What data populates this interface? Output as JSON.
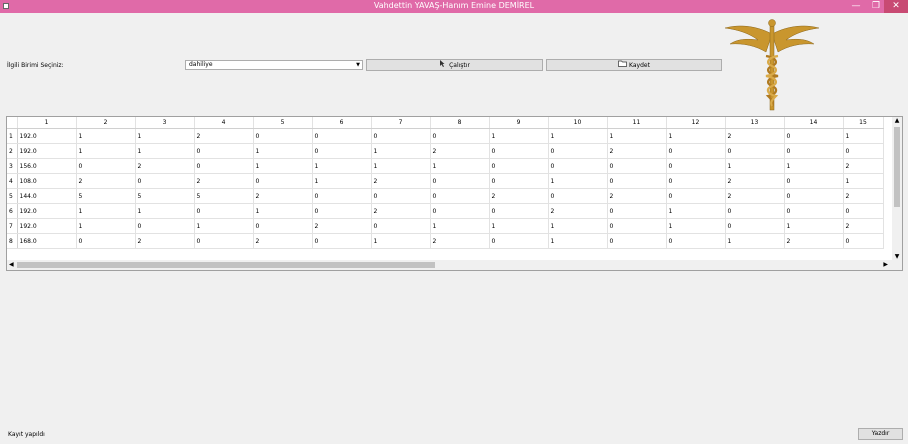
{
  "window": {
    "title": "Vahdettin YAVAŞ-Hanım Emine DEMİREL",
    "min": "—",
    "max": "❐",
    "close": "✕"
  },
  "form": {
    "label": "İlgili Birimi Seçiniz:",
    "selected_unit": "dahiliye",
    "run_label": "Çalıştır",
    "save_label": "Kaydet"
  },
  "table": {
    "columns": [
      "1",
      "2",
      "3",
      "4",
      "5",
      "6",
      "7",
      "8",
      "9",
      "10",
      "11",
      "12",
      "13",
      "14",
      "15"
    ],
    "rows": [
      {
        "n": "1",
        "cells": [
          "192.0",
          "1",
          "1",
          "2",
          "0",
          "0",
          "0",
          "0",
          "1",
          "1",
          "1",
          "1",
          "2",
          "0",
          "1"
        ]
      },
      {
        "n": "2",
        "cells": [
          "192.0",
          "1",
          "1",
          "0",
          "1",
          "0",
          "1",
          "2",
          "0",
          "0",
          "2",
          "0",
          "0",
          "0",
          "0"
        ]
      },
      {
        "n": "3",
        "cells": [
          "156.0",
          "0",
          "2",
          "0",
          "1",
          "1",
          "1",
          "1",
          "0",
          "0",
          "0",
          "0",
          "1",
          "1",
          "2"
        ]
      },
      {
        "n": "4",
        "cells": [
          "108.0",
          "2",
          "0",
          "2",
          "0",
          "1",
          "2",
          "0",
          "0",
          "1",
          "0",
          "0",
          "2",
          "0",
          "1"
        ]
      },
      {
        "n": "5",
        "cells": [
          "144.0",
          "5",
          "5",
          "5",
          "2",
          "0",
          "0",
          "0",
          "2",
          "0",
          "2",
          "0",
          "2",
          "0",
          "2"
        ]
      },
      {
        "n": "6",
        "cells": [
          "192.0",
          "1",
          "1",
          "0",
          "1",
          "0",
          "2",
          "0",
          "0",
          "2",
          "0",
          "1",
          "0",
          "0",
          "0"
        ]
      },
      {
        "n": "7",
        "cells": [
          "192.0",
          "1",
          "0",
          "1",
          "0",
          "2",
          "0",
          "1",
          "1",
          "1",
          "0",
          "1",
          "0",
          "1",
          "2"
        ]
      },
      {
        "n": "8",
        "cells": [
          "168.0",
          "0",
          "2",
          "0",
          "2",
          "0",
          "1",
          "2",
          "0",
          "1",
          "0",
          "0",
          "1",
          "2",
          "0"
        ]
      }
    ]
  },
  "status": {
    "message": "Kayıt yapıldı",
    "print_label": "Yazdır"
  },
  "colors": {
    "titlebar": "#e06aa8",
    "close": "#c84a73",
    "logo_gold": "#c9962e"
  }
}
